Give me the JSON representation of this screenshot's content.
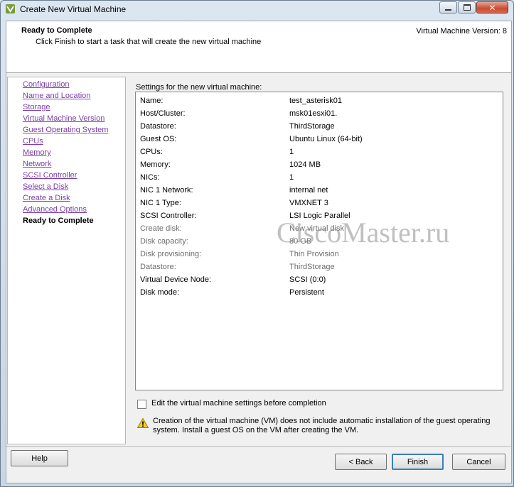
{
  "window": {
    "title": "Create New Virtual Machine",
    "controls": [
      "minimize",
      "maximize",
      "close"
    ]
  },
  "header": {
    "title": "Ready to Complete",
    "subtitle": "Click Finish to start a task that will create the new virtual machine",
    "version": "Virtual Machine Version: 8"
  },
  "sidebar": {
    "items": [
      {
        "label": "Configuration",
        "current": false
      },
      {
        "label": "Name and Location",
        "current": false
      },
      {
        "label": "Storage",
        "current": false
      },
      {
        "label": "Virtual Machine Version",
        "current": false
      },
      {
        "label": "Guest Operating System",
        "current": false
      },
      {
        "label": "CPUs",
        "current": false
      },
      {
        "label": "Memory",
        "current": false
      },
      {
        "label": "Network",
        "current": false
      },
      {
        "label": "SCSI Controller",
        "current": false
      },
      {
        "label": "Select a Disk",
        "current": false
      },
      {
        "label": "Create a Disk",
        "current": false
      },
      {
        "label": "Advanced Options",
        "current": false
      },
      {
        "label": "Ready to Complete",
        "current": true
      }
    ]
  },
  "settings": {
    "label": "Settings for the new virtual machine:",
    "rows": [
      {
        "key": "Name:",
        "value": "test_asterisk01",
        "dim": false
      },
      {
        "key": "Host/Cluster:",
        "value": "msk01esxi01.",
        "dim": false
      },
      {
        "key": "Datastore:",
        "value": "ThirdStorage",
        "dim": false
      },
      {
        "key": "Guest OS:",
        "value": "Ubuntu Linux (64-bit)",
        "dim": false
      },
      {
        "key": "CPUs:",
        "value": "1",
        "dim": false
      },
      {
        "key": "Memory:",
        "value": "1024 MB",
        "dim": false
      },
      {
        "key": "NICs:",
        "value": "1",
        "dim": false
      },
      {
        "key": "NIC 1 Network:",
        "value": "internal net",
        "dim": false
      },
      {
        "key": "NIC 1 Type:",
        "value": "VMXNET 3",
        "dim": false
      },
      {
        "key": "SCSI Controller:",
        "value": "LSI Logic Parallel",
        "dim": false
      },
      {
        "key": "Create disk:",
        "value": "New virtual disk",
        "dim": true
      },
      {
        "key": "Disk capacity:",
        "value": "80 GB",
        "dim": true
      },
      {
        "key": "Disk provisioning:",
        "value": "Thin Provision",
        "dim": true
      },
      {
        "key": "Datastore:",
        "value": "ThirdStorage",
        "dim": true
      },
      {
        "key": "Virtual Device Node:",
        "value": "SCSI (0:0)",
        "dim": false
      },
      {
        "key": "Disk mode:",
        "value": "Persistent",
        "dim": false
      }
    ]
  },
  "watermark": "CiscoMaster.ru",
  "edit_checkbox": {
    "label": "Edit the virtual machine settings before completion",
    "checked": false
  },
  "warning": {
    "icon": "warning-icon",
    "text": "Creation of the virtual machine (VM) does not include automatic installation of the guest operating system. Install a guest OS on the VM after creating the VM."
  },
  "buttons": {
    "help": "Help",
    "back": "< Back",
    "finish": "Finish",
    "cancel": "Cancel"
  },
  "colors": {
    "link": "#7b3fa6",
    "finish_border": "#3c7fb1",
    "close_button": "#c94a30"
  }
}
